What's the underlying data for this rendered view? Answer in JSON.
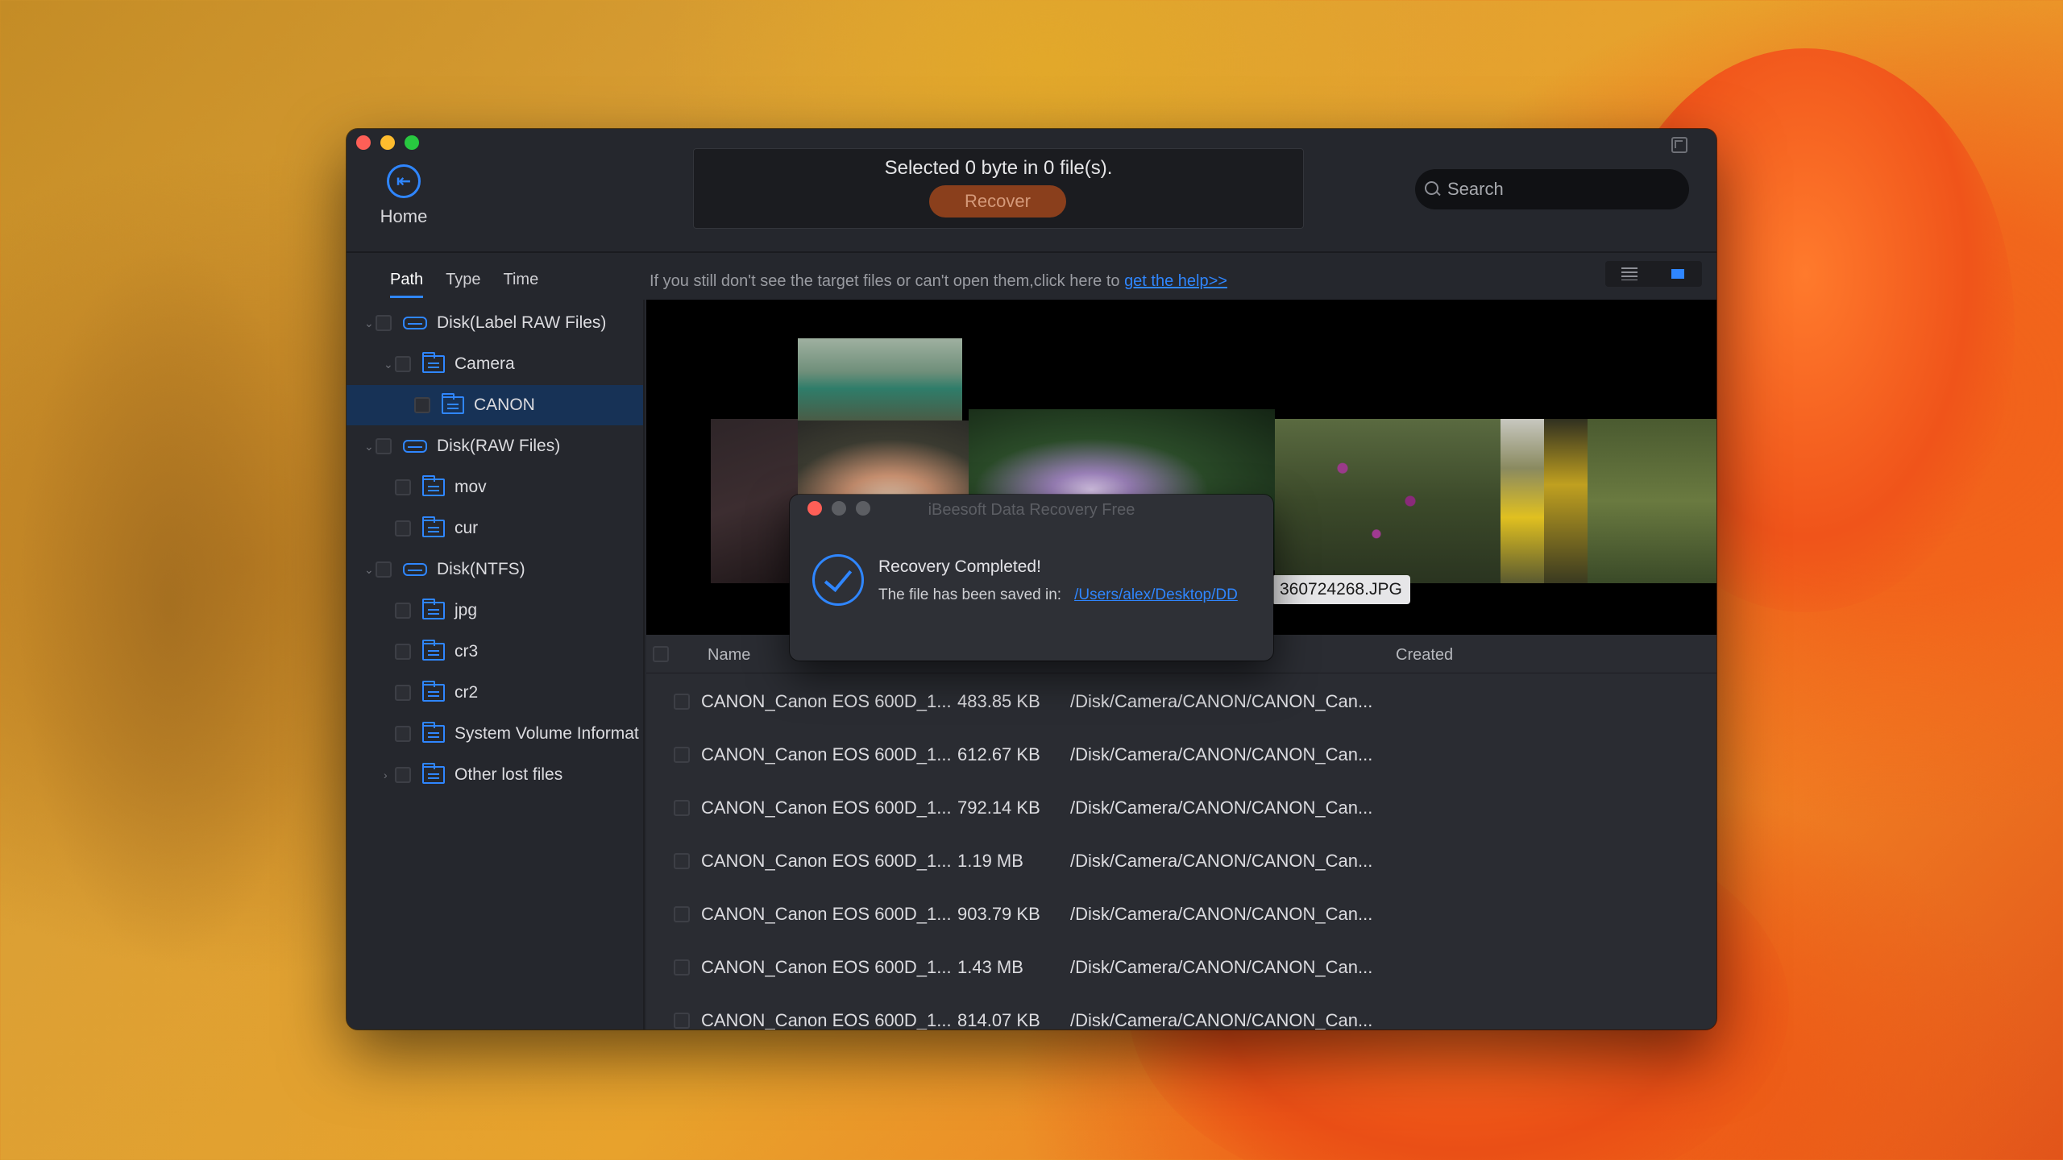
{
  "window": {
    "home_label": "Home",
    "selected_text": "Selected 0 byte in 0 file(s).",
    "recover_label": "Recover",
    "search_placeholder": "Search"
  },
  "tabs": [
    {
      "label": "Path",
      "active": true
    },
    {
      "label": "Type",
      "active": false
    },
    {
      "label": "Time",
      "active": false
    }
  ],
  "help": {
    "text": "If you still don't see the target files or can't open them,click here to ",
    "link": "get the help>>"
  },
  "tree": [
    {
      "label": "Disk(Label RAW Files)",
      "kind": "drive"
    },
    {
      "label": "Camera",
      "kind": "folder"
    },
    {
      "label": "CANON",
      "kind": "folder",
      "selected": true
    },
    {
      "label": "Disk(RAW Files)",
      "kind": "drive"
    },
    {
      "label": "mov",
      "kind": "folder"
    },
    {
      "label": "cur",
      "kind": "folder"
    },
    {
      "label": "Disk(NTFS)",
      "kind": "drive"
    },
    {
      "label": "jpg",
      "kind": "folder"
    },
    {
      "label": "cr3",
      "kind": "folder"
    },
    {
      "label": "cr2",
      "kind": "folder"
    },
    {
      "label": "System Volume Informat",
      "kind": "folder"
    },
    {
      "label": "Other lost files",
      "kind": "folder"
    }
  ],
  "preview": {
    "filename_tag": "360724268.JPG"
  },
  "table": {
    "headers": {
      "name": "Name",
      "created": "Created"
    },
    "rows": [
      {
        "name": "CANON_Canon EOS 600D_1...",
        "size": "483.85 KB",
        "path": "/Disk/Camera/CANON/CANON_Can..."
      },
      {
        "name": "CANON_Canon EOS 600D_1...",
        "size": "612.67 KB",
        "path": "/Disk/Camera/CANON/CANON_Can..."
      },
      {
        "name": "CANON_Canon EOS 600D_1...",
        "size": "792.14 KB",
        "path": "/Disk/Camera/CANON/CANON_Can..."
      },
      {
        "name": "CANON_Canon EOS 600D_1...",
        "size": "1.19 MB",
        "path": "/Disk/Camera/CANON/CANON_Can..."
      },
      {
        "name": "CANON_Canon EOS 600D_1...",
        "size": "903.79 KB",
        "path": "/Disk/Camera/CANON/CANON_Can..."
      },
      {
        "name": "CANON_Canon EOS 600D_1...",
        "size": "1.43 MB",
        "path": "/Disk/Camera/CANON/CANON_Can..."
      },
      {
        "name": "CANON_Canon EOS 600D_1...",
        "size": "814.07 KB",
        "path": "/Disk/Camera/CANON/CANON_Can..."
      }
    ]
  },
  "dialog": {
    "title": "iBeesoft Data Recovery Free",
    "heading": "Recovery Completed!",
    "saved_label": "The file has been saved in:",
    "saved_path": "/Users/alex/Desktop/DD"
  },
  "icons": {
    "home": "back-arrow-circle-icon",
    "search": "search-icon",
    "list_view": "list-view-icon",
    "grid_view": "grid-view-icon",
    "drive": "drive-icon",
    "folder": "folder-icon",
    "success": "checkmark-circle-icon"
  },
  "colors": {
    "accent": "#2f86ff",
    "recover": "#8a3f1c",
    "selected_row": "#173256"
  }
}
